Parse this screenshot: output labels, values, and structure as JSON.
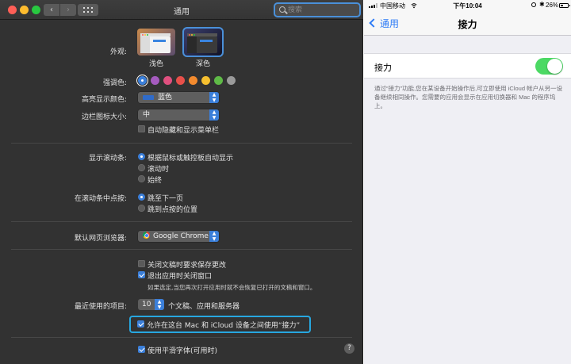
{
  "mac_window": {
    "title": "通用",
    "search_placeholder": "搜索",
    "back_glyph": "‹",
    "forward_glyph": "›"
  },
  "appearance": {
    "label": "外观:",
    "options": [
      {
        "name": "浅色",
        "selected": false
      },
      {
        "name": "深色",
        "selected": true
      }
    ]
  },
  "accent_color": {
    "label": "强调色:",
    "colors": [
      "#3b7fd9",
      "#a55bbf",
      "#e0507f",
      "#e8504a",
      "#f28a2e",
      "#f5bf2f",
      "#5fba47",
      "#9a9a9a"
    ],
    "selected_index": 0
  },
  "highlight_color": {
    "label": "高亮显示颜色:",
    "value": "蓝色",
    "swatch": "#2f6bc9"
  },
  "sidebar_icon_size": {
    "label": "边栏图标大小:",
    "value": "中"
  },
  "auto_hide_menu_bar": {
    "label": "自动隐藏和显示菜单栏",
    "checked": false
  },
  "show_scroll_bars": {
    "label": "显示滚动条:",
    "options": [
      {
        "label": "根据鼠标或触控板自动显示",
        "selected": true
      },
      {
        "label": "滚动时",
        "selected": false
      },
      {
        "label": "始终",
        "selected": false
      }
    ]
  },
  "click_in_scroll_bar": {
    "label": "在滚动条中点按:",
    "options": [
      {
        "label": "跳至下一页",
        "selected": true
      },
      {
        "label": "跳到点按的位置",
        "selected": false
      }
    ]
  },
  "default_browser": {
    "label": "默认网页浏览器:",
    "value": "Google Chrome"
  },
  "ask_keep_changes": {
    "label": "关闭文稿时要求保存更改",
    "checked": false
  },
  "close_windows": {
    "label": "退出应用时关闭窗口",
    "checked": true,
    "note": "如果选定,当您再次打开应用时就不会恢复已打开的文稿和窗口。"
  },
  "recent_items": {
    "label": "最近使用的项目:",
    "value": "10",
    "suffix": "个文稿、应用和服务器"
  },
  "allow_handoff": {
    "label": "允许在这台 Mac 和 iCloud 设备之间使用“接力”",
    "checked": true,
    "highlight_color": "#27a7e0"
  },
  "font_smoothing": {
    "label": "使用平滑字体(可用时)",
    "checked": true
  },
  "help_glyph": "?",
  "ios": {
    "status": {
      "carrier": "中国移动",
      "time": "下午10:04",
      "bluetooth": "✱",
      "battery": "26%"
    },
    "nav": {
      "back": "通用",
      "title": "接力"
    },
    "handoff_row": {
      "label": "接力",
      "on": true,
      "toggle_color": "#4cd964"
    },
    "footnote": "通过“接力”功能,您在某设备开始操作后,可立即使用 iCloud 帐户从另一设备继续相同操作。您需要的应用会显示在应用切换器和 Mac 的程序坞上。"
  }
}
